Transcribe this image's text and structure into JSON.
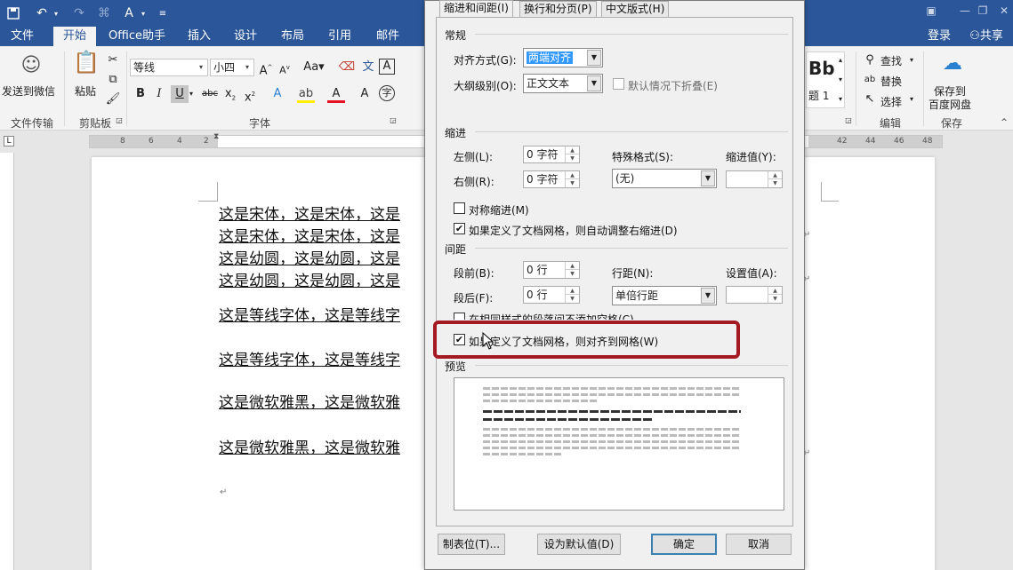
{
  "titlebar": {
    "qat_icons": [
      "save-icon",
      "undo-icon",
      "redo-icon",
      "format-painter-icon",
      "customize-icon"
    ],
    "window_controls": [
      "ribbon-options-icon",
      "minimize-icon",
      "restore-icon",
      "close-icon"
    ]
  },
  "tabs": {
    "items": [
      "文件",
      "开始",
      "Office助手",
      "插入",
      "设计",
      "布局",
      "引用",
      "邮件"
    ],
    "active": "开始",
    "login": "登录",
    "share": "共享"
  },
  "ribbon": {
    "wechat_label": "发送到微信",
    "wechat_group": "文件传输",
    "paste_label": "粘贴",
    "clipboard_group": "剪贴板",
    "font_name": "等线",
    "font_size": "小四",
    "font_group": "字体",
    "style_preview": "Bb",
    "style_name": "题 1",
    "find": "查找",
    "replace": "替换",
    "select": "选择",
    "edit_group": "编辑",
    "save_cloud": "保存到",
    "save_cloud2": "百度网盘",
    "save_group": "保存"
  },
  "ruler": {
    "left_nums": [
      "8",
      "6",
      "4",
      "2"
    ],
    "right_nums": [
      "42",
      "44",
      "46",
      "48"
    ]
  },
  "document": {
    "lines": [
      "这是宋体，这是宋体，这是",
      "这是宋体，这是宋体，这是",
      "这是幼圆，这是幼圆，这是",
      "这是幼圆，这是幼圆，这是",
      "这是等线字体，这是等线字",
      "这是等线字体，这是等线字",
      "这是微软雅黑，这是微软雅",
      "这是微软雅黑，这是微软雅"
    ],
    "para_mark": "↵"
  },
  "dialog": {
    "tabs": [
      "缩进和间距(I)",
      "换行和分页(P)",
      "中文版式(H)"
    ],
    "general_title": "常规",
    "align_label": "对齐方式(G):",
    "align_value": "两端对齐",
    "outline_label": "大纲级别(O):",
    "outline_value": "正文文本",
    "collapse_label": "默认情况下折叠(E)",
    "indent_title": "缩进",
    "left_label": "左侧(L):",
    "left_value": "0 字符",
    "right_label": "右侧(R):",
    "right_value": "0 字符",
    "special_label": "特殊格式(S):",
    "special_value": "(无)",
    "indent_by_label": "缩进值(Y):",
    "mirror_label": "对称缩进(M)",
    "auto_adjust_label": "如果定义了文档网格，则自动调整右缩进(D)",
    "spacing_title": "间距",
    "before_label": "段前(B):",
    "before_value": "0 行",
    "after_label": "段后(F):",
    "after_value": "0 行",
    "line_spacing_label": "行距(N):",
    "line_spacing_value": "单倍行距",
    "at_label": "设置值(A):",
    "no_space_label": "在相同样式的段落间不添加空格(C)",
    "snap_grid_label": "如果定义了文档网格，则对齐到网格(W)",
    "preview_title": "预览",
    "tabs_button": "制表位(T)...",
    "default_button": "设为默认值(D)",
    "ok_button": "确定",
    "cancel_button": "取消",
    "checked_mark": "✔"
  },
  "colors": {
    "brand": "#2b579a",
    "highlight": "#a51922",
    "selection": "#3399ff"
  }
}
